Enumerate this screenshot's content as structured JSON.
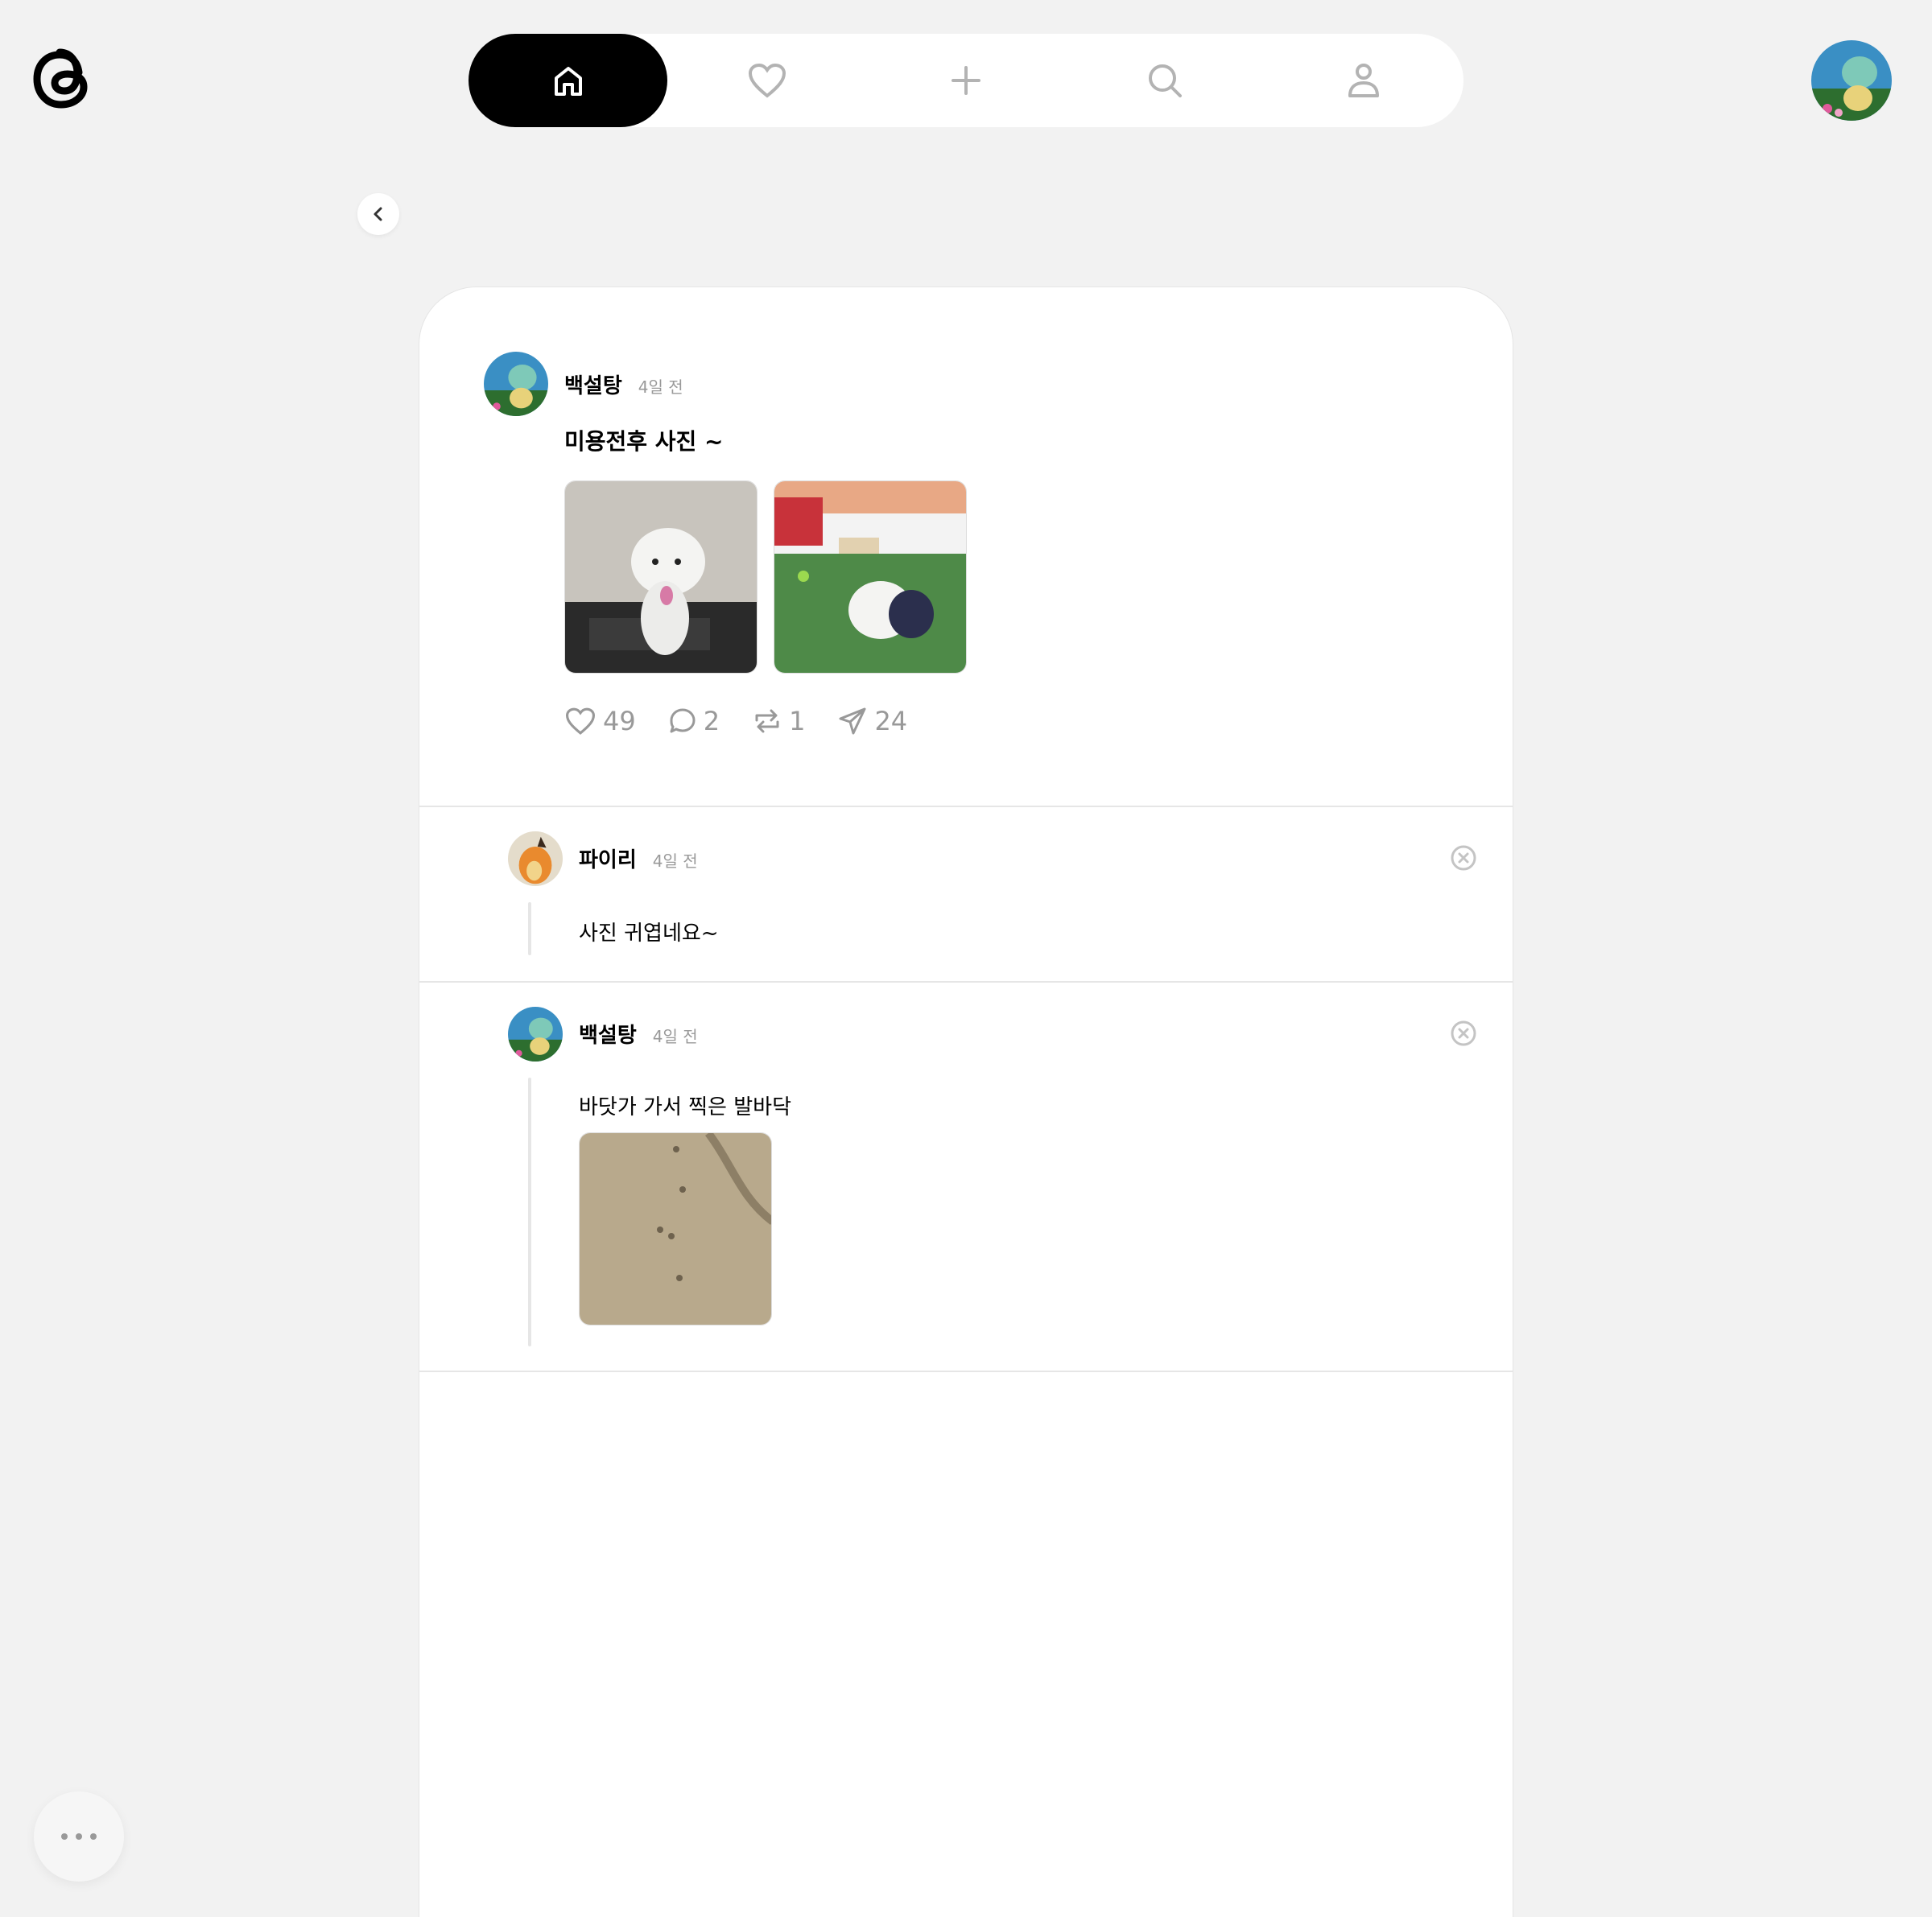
{
  "nav": {
    "items": [
      {
        "name": "home",
        "icon": "home-icon",
        "active": true
      },
      {
        "name": "activity",
        "icon": "heart-icon",
        "active": false
      },
      {
        "name": "create",
        "icon": "plus-icon",
        "active": false
      },
      {
        "name": "search",
        "icon": "search-icon",
        "active": false
      },
      {
        "name": "profile",
        "icon": "person-icon",
        "active": false
      }
    ]
  },
  "post": {
    "username": "백설탕",
    "time": "4일 전",
    "text": "미용전후 사진 ~",
    "likes": "49",
    "comments": "2",
    "reposts": "1",
    "shares": "24"
  },
  "replies": [
    {
      "username": "파이리",
      "time": "4일 전",
      "text": "사진 귀엽네요~"
    },
    {
      "username": "백설탕",
      "time": "4일 전",
      "text": "바닷가 가서 찍은 발바닥"
    }
  ],
  "colors": {
    "active": "#000000",
    "muted": "#999999",
    "divider": "#e6e6e6"
  }
}
